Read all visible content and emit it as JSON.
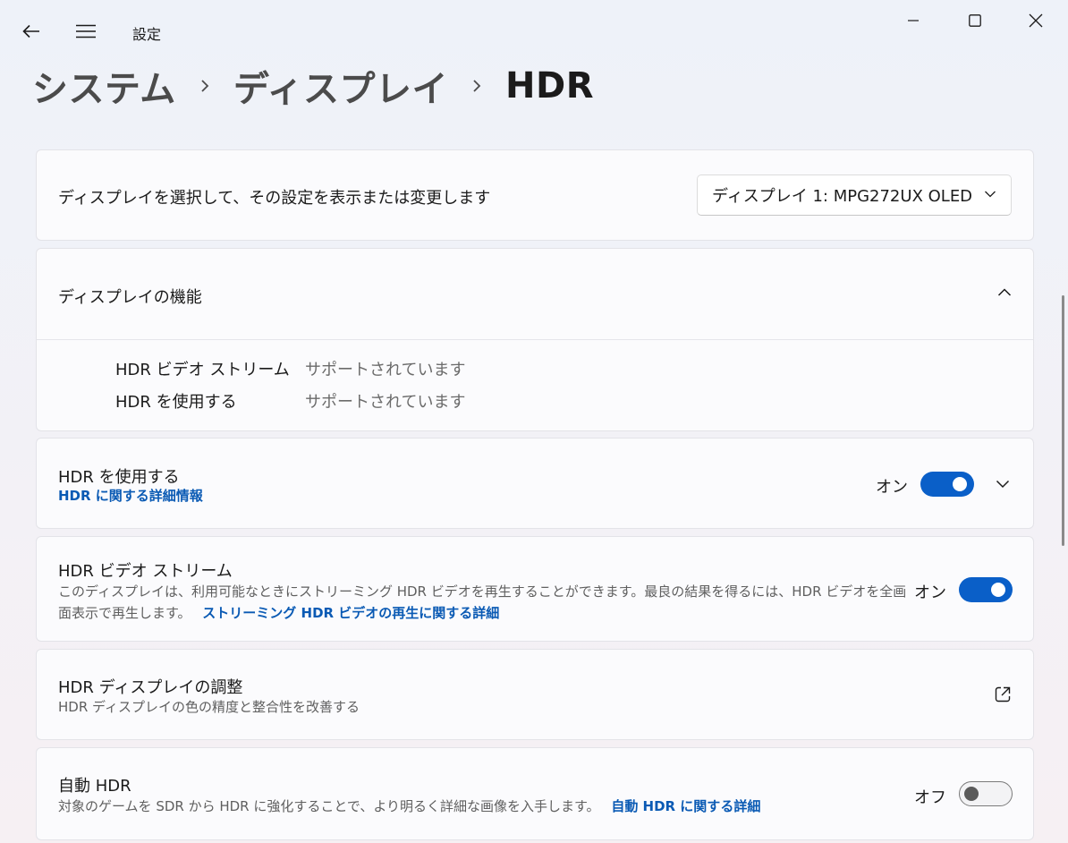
{
  "app": {
    "title": "設定"
  },
  "breadcrumb": {
    "items": [
      "システム",
      "ディスプレイ",
      "HDR"
    ]
  },
  "select_display": {
    "label": "ディスプレイを選択して、その設定を表示または変更します",
    "selected": "ディスプレイ 1: MPG272UX OLED"
  },
  "capabilities": {
    "title": "ディスプレイの機能",
    "rows": [
      {
        "name": "HDR ビデオ ストリーム",
        "value": "サポートされています"
      },
      {
        "name": "HDR を使用する",
        "value": "サポートされています"
      }
    ]
  },
  "use_hdr": {
    "title": "HDR を使用する",
    "link": "HDR に関する詳細情報",
    "state": "オン",
    "on": true
  },
  "video_stream": {
    "title": "HDR ビデオ ストリーム",
    "desc_line1": "このディスプレイは、利用可能なときにストリーミング HDR ビデオを再生することができます。最良の結果を得るには、HDR ビデオを全画",
    "desc_line2": "面表示で再生します。",
    "link": "ストリーミング HDR ビデオの再生に関する詳細",
    "state": "オン",
    "on": true
  },
  "calibration": {
    "title": "HDR ディスプレイの調整",
    "desc": "HDR ディスプレイの色の精度と整合性を改善する"
  },
  "auto_hdr": {
    "title": "自動 HDR",
    "desc": "対象のゲームを SDR から HDR に強化することで、より明るく詳細な画像を入手します。",
    "link": "自動 HDR に関する詳細",
    "state": "オフ",
    "on": false
  },
  "colors": {
    "accent": "#0a5fc8",
    "link": "#0a5ab4"
  }
}
